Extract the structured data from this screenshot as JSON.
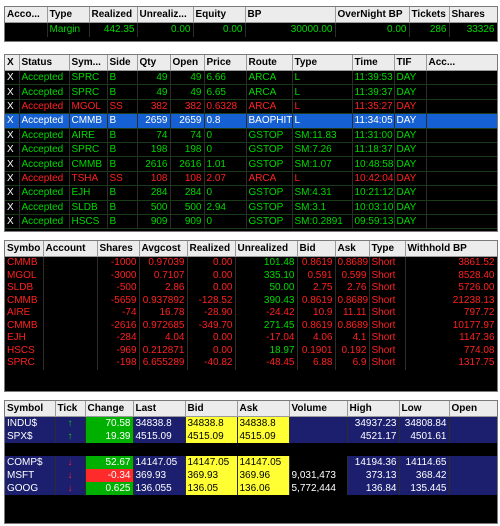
{
  "account_summary": {
    "headers": [
      "Acco...",
      "Type",
      "Realized",
      "Unrealiz...",
      "Equity",
      "BP",
      "OverNight BP",
      "Tickets",
      "Shares"
    ],
    "row": {
      "account": "",
      "type": "Margin",
      "realized": "442.35",
      "unrealized": "0.00",
      "equity": "0.00",
      "bp": "30000.00",
      "overnight_bp": "0.00",
      "tickets": "286",
      "shares": "33326"
    }
  },
  "orders": {
    "headers": [
      "X",
      "Status",
      "Sym...",
      "Side",
      "Qty",
      "Open",
      "Price",
      "Route",
      "Type",
      "Time",
      "TIF",
      "Acc..."
    ],
    "rows": [
      {
        "x": "X",
        "status": "Accepted",
        "symbol": "SPRC",
        "side": "B",
        "qty": "49",
        "open": "49",
        "price": "6.66",
        "route": "ARCA",
        "type": "L",
        "time": "11:39:53",
        "tif": "DAY",
        "color": "g"
      },
      {
        "x": "X",
        "status": "Accepted",
        "symbol": "SPRC",
        "side": "B",
        "qty": "49",
        "open": "49",
        "price": "6.65",
        "route": "ARCA",
        "type": "L",
        "time": "11:39:37",
        "tif": "DAY",
        "color": "g"
      },
      {
        "x": "X",
        "status": "Accepted",
        "symbol": "MGOL",
        "side": "SS",
        "qty": "382",
        "open": "382",
        "price": "0.6328",
        "route": "ARCA",
        "type": "L",
        "time": "11:35:27",
        "tif": "DAY",
        "color": "r"
      },
      {
        "x": "X",
        "status": "Accepted",
        "symbol": "CMMB",
        "side": "B",
        "qty": "2659",
        "open": "2659",
        "price": "0.8",
        "route": "BAOPHIT",
        "type": "L",
        "time": "11:34:05",
        "tif": "DAY",
        "color": "sel"
      },
      {
        "x": "X",
        "status": "Accepted",
        "symbol": "AIRE",
        "side": "B",
        "qty": "74",
        "open": "74",
        "price": "0",
        "route": "GSTOP",
        "type": "SM:11.83",
        "time": "11:31:00",
        "tif": "DAY",
        "color": "g"
      },
      {
        "x": "X",
        "status": "Accepted",
        "symbol": "SPRC",
        "side": "B",
        "qty": "198",
        "open": "198",
        "price": "0",
        "route": "GSTOP",
        "type": "SM:7.26",
        "time": "11:18:37",
        "tif": "DAY",
        "color": "g"
      },
      {
        "x": "X",
        "status": "Accepted",
        "symbol": "CMMB",
        "side": "B",
        "qty": "2616",
        "open": "2616",
        "price": "1.01",
        "route": "GSTOP",
        "type": "SM:1.07",
        "time": "10:48:58",
        "tif": "DAY",
        "color": "g"
      },
      {
        "x": "X",
        "status": "Accepted",
        "symbol": "TSHA",
        "side": "SS",
        "qty": "108",
        "open": "108",
        "price": "2.07",
        "route": "ARCA",
        "type": "L",
        "time": "10:42:04",
        "tif": "DAY",
        "color": "r"
      },
      {
        "x": "X",
        "status": "Accepted",
        "symbol": "EJH",
        "side": "B",
        "qty": "284",
        "open": "284",
        "price": "0",
        "route": "GSTOP",
        "type": "SM:4.31",
        "time": "10:21:12",
        "tif": "DAY",
        "color": "g"
      },
      {
        "x": "X",
        "status": "Accepted",
        "symbol": "SLDB",
        "side": "B",
        "qty": "500",
        "open": "500",
        "price": "2.94",
        "route": "GSTOP",
        "type": "SM:3.1",
        "time": "10:03:10",
        "tif": "DAY",
        "color": "g"
      },
      {
        "x": "X",
        "status": "Accepted",
        "symbol": "HSCS",
        "side": "B",
        "qty": "909",
        "open": "909",
        "price": "0",
        "route": "GSTOP",
        "type": "SM:0.2891",
        "time": "09:59:13",
        "tif": "DAY",
        "color": "g"
      }
    ]
  },
  "positions": {
    "headers": [
      "Symbo",
      "Account",
      "Shares",
      "Avgcost",
      "Realized",
      "Unrealized",
      "Bid",
      "Ask",
      "Type",
      "Withhold BP"
    ],
    "rows": [
      {
        "symbol": "CMMB",
        "shares": "-1000",
        "avgcost": "0.97039",
        "realized": "0.00",
        "unrealized": "101.48",
        "bid": "0.8619",
        "ask": "0.8689",
        "type": "Short",
        "withhold": "3861.52",
        "ucolor": "g"
      },
      {
        "symbol": "MGOL",
        "shares": "-3000",
        "avgcost": "0.7107",
        "realized": "0.00",
        "unrealized": "335.10",
        "bid": "0.591",
        "ask": "0.599",
        "type": "Short",
        "withhold": "8528.40",
        "ucolor": "g"
      },
      {
        "symbol": "SLDB",
        "shares": "-500",
        "avgcost": "2.86",
        "realized": "0.00",
        "unrealized": "50.00",
        "bid": "2.75",
        "ask": "2.76",
        "type": "Short",
        "withhold": "5726.00",
        "ucolor": "g"
      },
      {
        "symbol": "CMMB",
        "shares": "-5659",
        "avgcost": "0.937892",
        "realized": "-128.52",
        "unrealized": "390.43",
        "bid": "0.8619",
        "ask": "0.8689",
        "type": "Short",
        "withhold": "21238.13",
        "ucolor": "g"
      },
      {
        "symbol": "AIRE",
        "shares": "-74",
        "avgcost": "16.78",
        "realized": "-28.90",
        "unrealized": "-24.42",
        "bid": "10.9",
        "ask": "11.11",
        "type": "Short",
        "withhold": "797.72",
        "ucolor": "r"
      },
      {
        "symbol": "CMMB",
        "shares": "-2616",
        "avgcost": "0.972685",
        "realized": "-349.70",
        "unrealized": "271.45",
        "bid": "0.8619",
        "ask": "0.8689",
        "type": "Short",
        "withhold": "10177.97",
        "ucolor": "g"
      },
      {
        "symbol": "EJH",
        "shares": "-284",
        "avgcost": "4.04",
        "realized": "0.00",
        "unrealized": "-17.04",
        "bid": "4.06",
        "ask": "4.1",
        "type": "Short",
        "withhold": "1147.36",
        "ucolor": "r"
      },
      {
        "symbol": "HSCS",
        "shares": "-969",
        "avgcost": "0.212871",
        "realized": "0.00",
        "unrealized": "18.97",
        "bid": "0.1901",
        "ask": "0.192",
        "type": "Short",
        "withhold": "774.08",
        "ucolor": "g"
      },
      {
        "symbol": "SPRC",
        "shares": "-198",
        "avgcost": "6.655289",
        "realized": "-40.82",
        "unrealized": "-48.45",
        "bid": "6.88",
        "ask": "6.9",
        "type": "Short",
        "withhold": "1317.75",
        "ucolor": "r"
      }
    ]
  },
  "quotes": {
    "headers": [
      "Symbol",
      "Tick",
      "Change",
      "Last",
      "Bid",
      "Ask",
      "Volume",
      "High",
      "Low",
      "Open"
    ],
    "group1": [
      {
        "symbol": "INDU$",
        "tick": "up",
        "change": "70.58",
        "last": "34838.8",
        "bid": "34838.8",
        "ask": "34838.8",
        "volume": "",
        "high": "34937.23",
        "low": "34808.84",
        "open": ""
      },
      {
        "symbol": "SPX$",
        "tick": "up",
        "change": "19.39",
        "last": "4515.09",
        "bid": "4515.09",
        "ask": "4515.09",
        "volume": "",
        "high": "4521.17",
        "low": "4501.61",
        "open": ""
      }
    ],
    "group2": [
      {
        "symbol": "COMP$",
        "tick": "down",
        "change": "52.67",
        "last": "14147.05",
        "bid": "14147.05",
        "ask": "14147.05",
        "volume": "",
        "high": "14194.36",
        "low": "14114.65",
        "open": "",
        "chg": "g"
      },
      {
        "symbol": "MSFT",
        "tick": "down",
        "change": "-0.34",
        "last": "369.93",
        "bid": "369.93",
        "ask": "369.96",
        "volume": "9,031,473",
        "high": "373.13",
        "low": "368.42",
        "open": "",
        "chg": "r"
      },
      {
        "symbol": "GOOG",
        "tick": "down",
        "change": "0.625",
        "last": "136.055",
        "bid": "136.05",
        "ask": "136.06",
        "volume": "5,772,444",
        "high": "136.84",
        "low": "135.445",
        "open": "",
        "chg": "g"
      }
    ],
    "colors": {
      "up": "#00d800",
      "down": "#ff2020",
      "highlight": "#ffff33",
      "navy": "#1b1f6e"
    }
  }
}
